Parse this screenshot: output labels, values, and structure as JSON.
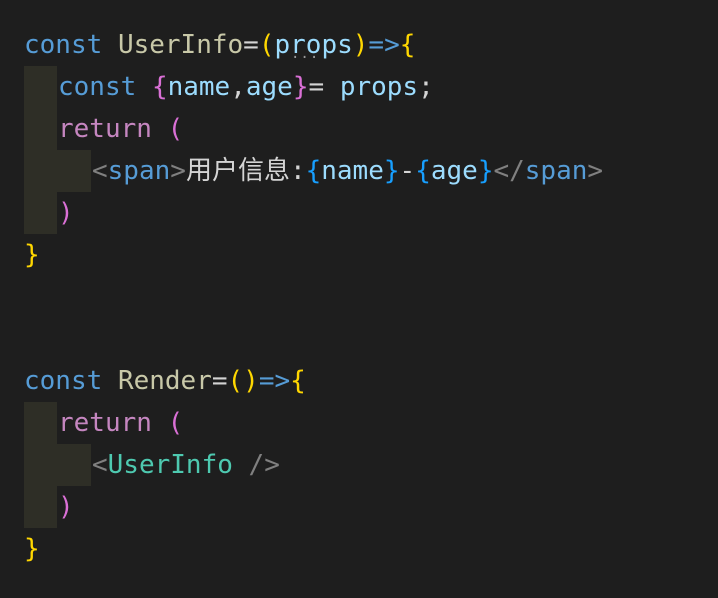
{
  "code": {
    "line1": {
      "kw": "const",
      "name": "UserInfo",
      "eq": "=",
      "paren_open": "(",
      "param": "props",
      "paren_close": ")",
      "arrow": "=>",
      "brace": "{"
    },
    "line2": {
      "kw": "const",
      "brace_open": "{",
      "v1": "name",
      "comma": ",",
      "v2": "age",
      "brace_close": "}",
      "eq": "= ",
      "src": "props",
      "semi": ";"
    },
    "line3": {
      "kw": "return",
      "paren": "("
    },
    "line4": {
      "lt": "<",
      "tag": "span",
      "gt": ">",
      "text": "用户信息:",
      "b1o": "{",
      "v1": "name",
      "b1c": "}",
      "dash": "-",
      "b2o": "{",
      "v2": "age",
      "b2c": "}",
      "close_lt": "</",
      "close_tag": "span",
      "close_gt": ">"
    },
    "line5": {
      "paren": ")"
    },
    "line6": {
      "brace": "}"
    },
    "line9": {
      "kw": "const",
      "name": "Render",
      "eq": "=",
      "parens": "()",
      "arrow": "=>",
      "brace": "{"
    },
    "line10": {
      "kw": "return",
      "paren": "("
    },
    "line11": {
      "lt": "<",
      "comp": "UserInfo",
      "self_close": "/>"
    },
    "line12": {
      "paren": ")"
    },
    "line13": {
      "brace": "}"
    }
  }
}
